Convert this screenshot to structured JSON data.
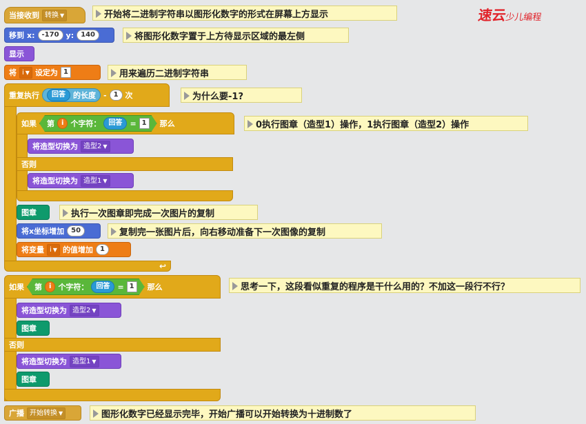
{
  "watermark": {
    "brand": "速云",
    "sub": "少儿编程"
  },
  "blocks": {
    "when_receive": {
      "label": "当接收到",
      "message": "转换"
    },
    "goto": {
      "label": "移到",
      "x_label": "x:",
      "x_value": "-170",
      "y_label": "y:",
      "y_value": "140"
    },
    "show": {
      "label": "显示"
    },
    "set_var": {
      "label": "将",
      "var": "i",
      "to": "设定为",
      "value": "1"
    },
    "repeat": {
      "label": "重复执行",
      "answer": "回答",
      "length": "的长度",
      "minus": "-",
      "one": "1",
      "times": "次"
    },
    "if1": {
      "label": "如果",
      "nth": "第",
      "var": "i",
      "char_of": "个字符：",
      "answer": "回答",
      "eq": "=",
      "value": "1",
      "then": "那么"
    },
    "costume2a": {
      "label": "将造型切换为",
      "costume": "造型2"
    },
    "else1": {
      "label": "否则"
    },
    "costume1a": {
      "label": "将造型切换为",
      "costume": "造型1"
    },
    "stamp1": {
      "label": "图章"
    },
    "change_x": {
      "label": "将x坐标增加",
      "value": "50"
    },
    "change_var": {
      "label": "将变量",
      "var": "i",
      "by": "的值增加",
      "value": "1"
    },
    "if2": {
      "label": "如果",
      "nth": "第",
      "var": "i",
      "char_of": "个字符：",
      "answer": "回答",
      "eq": "=",
      "value": "1",
      "then": "那么"
    },
    "costume2b": {
      "label": "将造型切换为",
      "costume": "造型2"
    },
    "stamp2": {
      "label": "图章"
    },
    "else2": {
      "label": "否则"
    },
    "costume1b": {
      "label": "将造型切换为",
      "costume": "造型1"
    },
    "stamp3": {
      "label": "图章"
    },
    "broadcast": {
      "label": "广播",
      "message": "开始转换"
    }
  },
  "notes": [
    "开始将二进制字符串以图形化数字的形式在屏幕上方显示",
    "将图形化数字置于上方待显示区域的最左侧",
    "用来遍历二进制字符串",
    "为什么要-1?",
    "0执行图章（造型1）操作，1执行图章（造型2）操作",
    "执行一次图章即完成一次图片的复制",
    "复制完一张图片后，向右移动准备下一次图像的复制",
    "思考一下，这段看似重复的程序是干什么用的？不加这一段行不行？",
    "图形化数字已经显示完毕，开始广播可以开始转换为十进制数了"
  ]
}
